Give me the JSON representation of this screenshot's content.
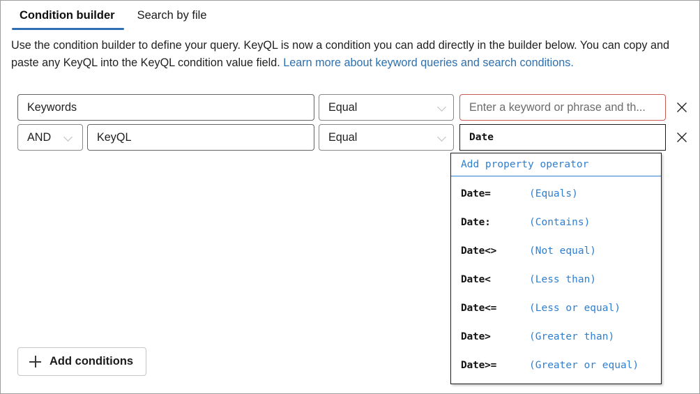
{
  "tabs": [
    {
      "label": "Condition builder",
      "selected": true
    },
    {
      "label": "Search by file",
      "selected": false
    }
  ],
  "description": {
    "text_before_link": "Use the condition builder to define your query. KeyQL is now a condition you can add directly in the builder below. You can copy and paste any KeyQL into the KeyQL condition value field. ",
    "link_text": "Learn more about keyword queries and search conditions."
  },
  "conditions": [
    {
      "property": "Keywords",
      "operator": "Equal",
      "value": "",
      "value_placeholder": "Enter a keyword or phrase and th...",
      "has_error": true,
      "remove_label": "Remove condition"
    },
    {
      "conjunction": "AND",
      "property": "KeyQL",
      "operator": "Equal",
      "value": "Date",
      "value_placeholder": "",
      "has_error": false,
      "remove_label": "Remove condition"
    }
  ],
  "suggestions": {
    "header": "Add property operator",
    "items": [
      {
        "token": "Date=",
        "description": "(Equals)"
      },
      {
        "token": "Date:",
        "description": "(Contains)"
      },
      {
        "token": "Date<>",
        "description": "(Not equal)"
      },
      {
        "token": "Date<",
        "description": "(Less than)"
      },
      {
        "token": "Date<=",
        "description": "(Less or equal)"
      },
      {
        "token": "Date>",
        "description": "(Greater than)"
      },
      {
        "token": "Date>=",
        "description": "(Greater or equal)"
      }
    ]
  },
  "add_conditions": {
    "label": "Add conditions"
  },
  "colors": {
    "accent": "#2e6eb5",
    "link": "#2f6fad",
    "error_border": "#c85a54",
    "suggestion_blue": "#2f7fd0",
    "border": "#8a8886"
  }
}
